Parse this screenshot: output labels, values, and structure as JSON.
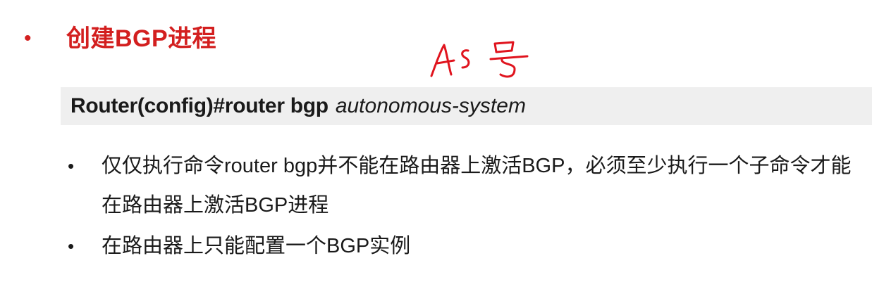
{
  "slide": {
    "title_bullet": "•",
    "title": "创建BGP进程",
    "command": {
      "bold_part": "Router(config)#router bgp",
      "italic_part": "autonomous-system"
    },
    "bullets": [
      {
        "dot": "•",
        "text": "仅仅执行命令router bgp并不能在路由器上激活BGP，必须至少执行一个子命令才能在路由器上激活BGP进程"
      },
      {
        "dot": "•",
        "text": "在路由器上只能配置一个BGP实例"
      }
    ],
    "handwritten_annotation": "AS号"
  },
  "colors": {
    "title": "#d31f1f",
    "annotation_ink": "#e0141e",
    "command_background": "#efefef",
    "text": "#1a1a1a"
  }
}
